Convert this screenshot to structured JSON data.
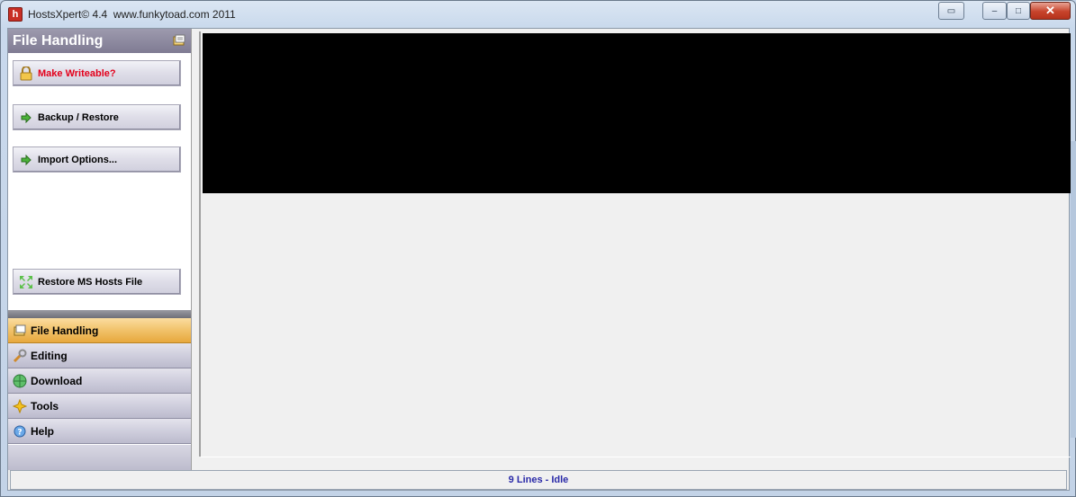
{
  "window": {
    "title": "HostsXpert© 4.4  www.funkytoad.com 2011",
    "app_icon": "h",
    "controls": {
      "special": "▭",
      "minimize": "–",
      "maximize": "□",
      "close": "✕"
    }
  },
  "panel": {
    "title": "File Handling",
    "header_icon": "file-handling-icon",
    "buttons": [
      {
        "label": "Make Writeable?",
        "icon": "lock-icon",
        "color": "#e3001b"
      },
      {
        "label": "Backup / Restore",
        "icon": "green-arrow-icon"
      },
      {
        "label": "Import Options...",
        "icon": "green-arrow-icon"
      },
      {
        "label": "Restore MS Hosts File",
        "icon": "restore-arrows-icon"
      }
    ]
  },
  "nav": {
    "items": [
      {
        "label": "File Handling",
        "icon": "file-handling-icon",
        "active": true
      },
      {
        "label": "Editing",
        "icon": "wrench-icon",
        "active": false
      },
      {
        "label": "Download",
        "icon": "globe-icon",
        "active": false
      },
      {
        "label": "Tools",
        "icon": "tools-icon",
        "active": false
      },
      {
        "label": "Help",
        "icon": "help-icon",
        "active": false
      }
    ]
  },
  "status": {
    "text": "9 Lines - Idle"
  },
  "colors": {
    "accent_active": "#f1c26a",
    "status_text": "#2a2aa8",
    "warning_text": "#e3001b"
  }
}
